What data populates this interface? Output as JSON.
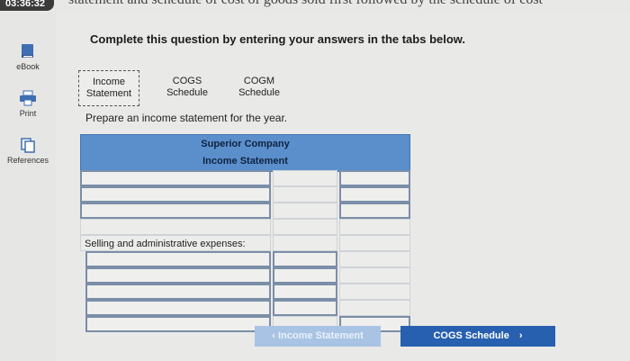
{
  "timer": "03:36:32",
  "top_text": "statement and schedule of cost of goods sold first followed by the schedule of cost",
  "sidebar": {
    "ebook": "eBook",
    "print": "Print",
    "references": "References"
  },
  "heading": "Complete this question by entering your answers in the tabs below.",
  "tabs": [
    {
      "line1": "Income",
      "line2": "Statement"
    },
    {
      "line1": "COGS",
      "line2": "Schedule"
    },
    {
      "line1": "COGM",
      "line2": "Schedule"
    }
  ],
  "instruction": "Prepare an income statement for the year.",
  "table": {
    "company": "Superior Company",
    "statement": "Income Statement",
    "selling_admin_label": "Selling and administrative expenses:"
  },
  "nav": {
    "prev": "Income Statement",
    "next": "COGS Schedule"
  },
  "colors": {
    "header_blue": "#5b8fcc",
    "next_button": "#2860b0",
    "prev_button": "#a8c3e4"
  }
}
